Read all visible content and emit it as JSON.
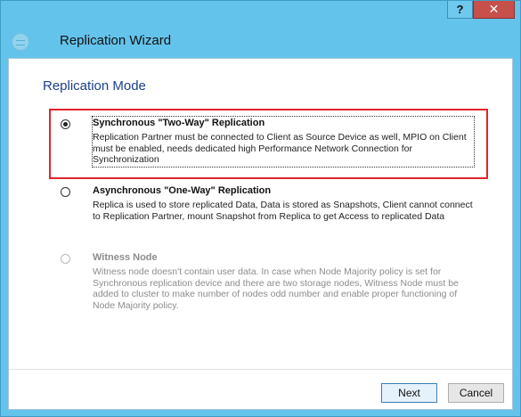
{
  "window": {
    "title": "Replication Wizard",
    "help_label": "?",
    "close_label": "✕",
    "close_color": "#c7504b",
    "accent_color": "#64c3eb"
  },
  "page": {
    "title": "Replication Mode"
  },
  "options": [
    {
      "title": "Synchronous \"Two-Way\" Replication",
      "description": "Replication Partner must be connected to Client as Source Device as well, MPIO on Client must be enabled, needs dedicated high Performance Network Connection for Synchronization",
      "selected": true,
      "enabled": true
    },
    {
      "title": "Asynchronous \"One-Way\" Replication",
      "description": "Replica is used to store replicated Data, Data is stored as Snapshots, Client cannot connect to Replication Partner, mount Snapshot from Replica to get Access to replicated Data",
      "selected": false,
      "enabled": true
    },
    {
      "title": "Witness Node",
      "description": "Witness node doesn't contain user data. In case when Node Majority policy is set for Synchronous replication device and there are two storage nodes, Witness Node must be added to cluster to make number of nodes odd number and enable proper functioning of Node Majority policy.",
      "selected": false,
      "enabled": false
    }
  ],
  "highlight_color": "#e0242a",
  "footer": {
    "next_label": "Next",
    "cancel_label": "Cancel"
  }
}
